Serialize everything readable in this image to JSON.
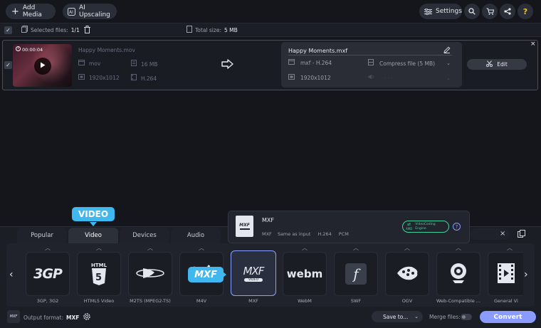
{
  "toolbar": {
    "add_media": "Add Media",
    "ai_upscaling": "AI Upscaling",
    "settings": "Settings"
  },
  "selection": {
    "selected_label": "Selected files:",
    "selected_count": "1/1",
    "total_label": "Total size:",
    "total_value": "5 MB"
  },
  "file": {
    "thumb_duration": "00:00:04",
    "source_name": "Happy Moments.mov",
    "source_format": "mov",
    "source_size": "16 MB",
    "source_resolution": "1920x1012",
    "source_codec": "H.264",
    "output_name": "Happy Moments.mxf",
    "output_format": "mxf - H.264",
    "compress": "Compress file (5 MB)",
    "output_resolution": "1920x1012",
    "edit": "Edit"
  },
  "tooltip": {
    "badge": "VIDEO",
    "format_title": "MXF",
    "specs": [
      "MXF",
      "Same as input",
      "H.264",
      "PCM"
    ],
    "engine_line1": "VideoCoding",
    "engine_line2": "Engine",
    "engine_amd": "AMD"
  },
  "drag_label": "MXF",
  "tabs": [
    "Popular",
    "Video",
    "Devices",
    "Audio"
  ],
  "formats": [
    {
      "label": "3GP, 3G2",
      "logo": "3GP"
    },
    {
      "label": "HTML5 Video",
      "logo": "HTML"
    },
    {
      "label": "M2TS (MPEG2-TS)",
      "logo": "bluray"
    },
    {
      "label": "M4V",
      "logo": ""
    },
    {
      "label": "MXF",
      "logo": "MXF"
    },
    {
      "label": "WebM",
      "logo": "webm"
    },
    {
      "label": "SWF",
      "logo": "f"
    },
    {
      "label": "OGV",
      "logo": "ogv"
    },
    {
      "label": "Web-Compatible ...",
      "logo": "webcam"
    },
    {
      "label": "General Vi",
      "logo": "film"
    }
  ],
  "bottom": {
    "output_label": "Output format:",
    "output_value": "MXF",
    "save_to": "Save to...",
    "merge": "Merge files:",
    "convert": "Convert"
  },
  "colors": {
    "accent": "#3fb8f0",
    "convert": "#8a9cff",
    "engine": "#3fd29a"
  }
}
